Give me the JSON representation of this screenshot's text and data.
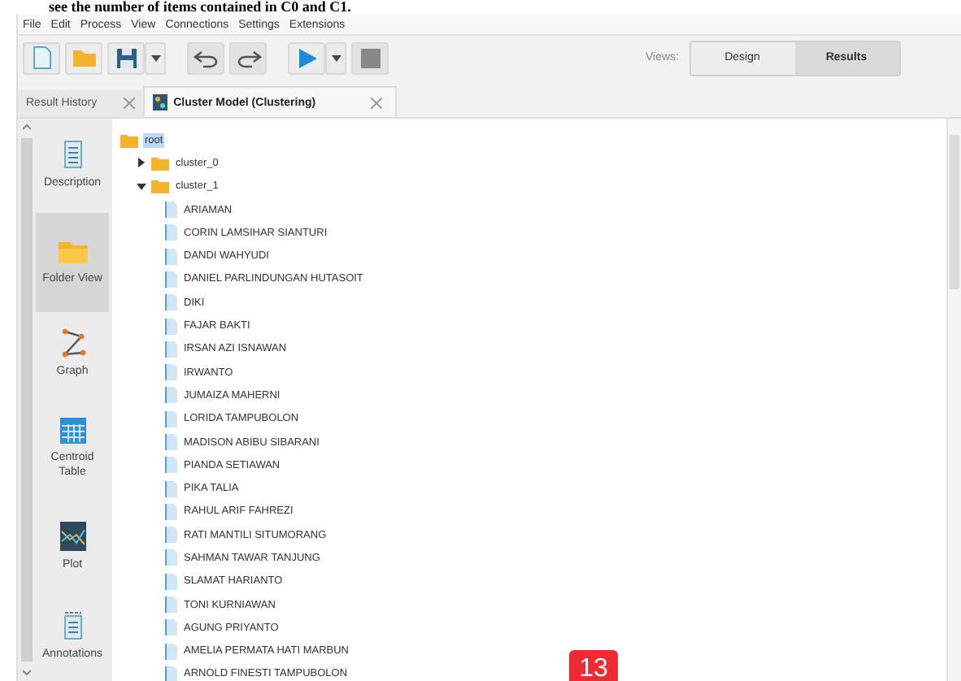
{
  "caption": "see the number of items contained in C0 and C1.",
  "menu": [
    "File",
    "Edit",
    "Process",
    "View",
    "Connections",
    "Settings",
    "Extensions"
  ],
  "toolbar": {
    "views_label": "Views:",
    "views": [
      {
        "label": "Design",
        "selected": false
      },
      {
        "label": "Results",
        "selected": true
      }
    ]
  },
  "tabs": [
    {
      "label": "Result History",
      "selected": false
    },
    {
      "label": "Cluster Model (Clustering)",
      "selected": true
    }
  ],
  "sidebar": {
    "items": [
      {
        "kind": "description",
        "label": "Description",
        "selected": false
      },
      {
        "kind": "folder",
        "label": "Folder View",
        "selected": true
      },
      {
        "kind": "graph",
        "label": "Graph",
        "selected": false
      },
      {
        "kind": "table",
        "label": "Centroid Table",
        "selected": false
      },
      {
        "kind": "plot",
        "label": "Plot",
        "selected": false
      },
      {
        "kind": "annotations",
        "label": "Annotations",
        "selected": false
      }
    ]
  },
  "tree": {
    "kind": "folder",
    "label": "root",
    "selected": true,
    "children": [
      {
        "kind": "folder",
        "label": "cluster_0",
        "selected": false,
        "expanded": false
      },
      {
        "kind": "folder",
        "label": "cluster_1",
        "selected": false,
        "expanded": true,
        "children": [
          {
            "kind": "item",
            "label": "ARIAMAN",
            "selected": false
          },
          {
            "kind": "item",
            "label": "CORIN LAMSIHAR SIANTURI",
            "selected": false
          },
          {
            "kind": "item",
            "label": "DANDI WAHYUDI",
            "selected": false
          },
          {
            "kind": "item",
            "label": "DANIEL PARLINDUNGAN HUTASOIT",
            "selected": false
          },
          {
            "kind": "item",
            "label": "DIKI",
            "selected": false
          },
          {
            "kind": "item",
            "label": "FAJAR BAKTI",
            "selected": false
          },
          {
            "kind": "item",
            "label": "IRSAN AZI ISNAWAN",
            "selected": false
          },
          {
            "kind": "item",
            "label": "IRWANTO",
            "selected": false
          },
          {
            "kind": "item",
            "label": "JUMAIZA MAHERNI",
            "selected": false
          },
          {
            "kind": "item",
            "label": "LORIDA TAMPUBOLON",
            "selected": false
          },
          {
            "kind": "item",
            "label": "MADISON ABIBU SIBARANI",
            "selected": false
          },
          {
            "kind": "item",
            "label": "PIANDA SETIAWAN",
            "selected": false
          },
          {
            "kind": "item",
            "label": "PIKA TALIA",
            "selected": false
          },
          {
            "kind": "item",
            "label": "RAHUL ARIF FAHREZI",
            "selected": false
          },
          {
            "kind": "item",
            "label": "RATI MANTILI SITUMORANG",
            "selected": false
          },
          {
            "kind": "item",
            "label": "SAHMAN TAWAR TANJUNG",
            "selected": false
          },
          {
            "kind": "item",
            "label": "SLAMAT HARIANTO",
            "selected": false
          },
          {
            "kind": "item",
            "label": "TONI KURNIAWAN",
            "selected": false
          },
          {
            "kind": "item",
            "label": "AGUNG PRIYANTO",
            "selected": false
          },
          {
            "kind": "item",
            "label": "AMELIA PERMATA HATI MARBUN",
            "selected": false
          },
          {
            "kind": "item",
            "label": "ARNOLD FINESTI TAMPUBOLON",
            "selected": false
          }
        ]
      }
    ]
  },
  "page_badge": "13"
}
